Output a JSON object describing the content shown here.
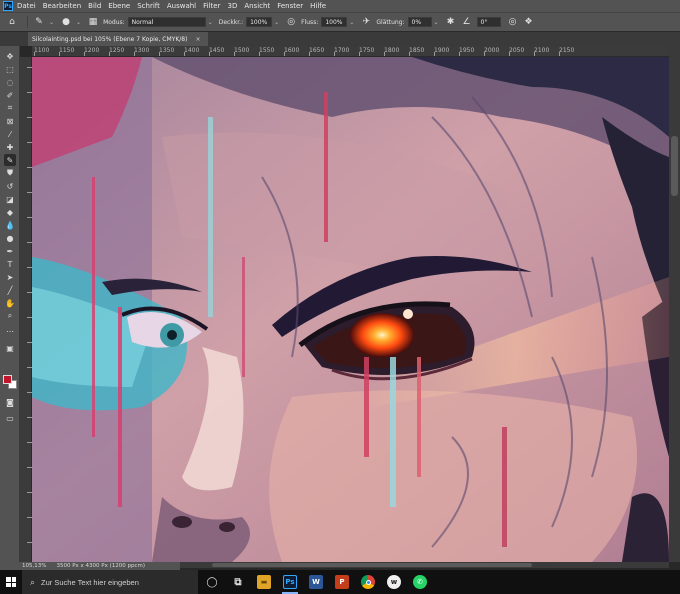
{
  "app": {
    "logo": "Ps"
  },
  "menu": [
    "Datei",
    "Bearbeiten",
    "Bild",
    "Ebene",
    "Schrift",
    "Auswahl",
    "Filter",
    "3D",
    "Ansicht",
    "Fenster",
    "Hilfe"
  ],
  "options": {
    "modus_label": "Modus:",
    "modus_value": "Normal",
    "deckkraft_label": "Deckkr.:",
    "deckkraft_value": "100%",
    "fluss_label": "Fluss:",
    "fluss_value": "100%",
    "glaettung_label": "Glättung:",
    "glaettung_value": "0%",
    "angle_value": "0°"
  },
  "document": {
    "tab_title": "Silcolainting.psd bei 105% (Ebene 7 Kopie, CMYK/8)",
    "close_glyph": "×"
  },
  "ruler": {
    "ticks": [
      "1100",
      "1150",
      "1200",
      "1250",
      "1300",
      "1350",
      "1400",
      "1450",
      "1500",
      "1550",
      "1600",
      "1650",
      "1700",
      "1750",
      "1800",
      "1850",
      "1900",
      "1950",
      "2000",
      "2050",
      "2100",
      "2150"
    ]
  },
  "status": {
    "zoom": "105,13%",
    "doc_info": "3500 Px x 4300 Px (1200 ppcm)"
  },
  "taskbar": {
    "search_placeholder": "Zur Suche Text hier eingeben",
    "apps": [
      {
        "name": "task-view",
        "glyph": "◯",
        "color": "#101010"
      },
      {
        "name": "task-switcher",
        "glyph": "⧉",
        "color": "#101010"
      },
      {
        "name": "file-explorer",
        "glyph": "▬",
        "color": "#e0a526"
      },
      {
        "name": "photoshop",
        "glyph": "Ps",
        "color": "#0d1b33"
      },
      {
        "name": "word",
        "glyph": "W",
        "color": "#2b5797"
      },
      {
        "name": "powerpoint",
        "glyph": "P",
        "color": "#c43e1c"
      },
      {
        "name": "chrome",
        "glyph": "●",
        "color": "#d9463a"
      },
      {
        "name": "wattpad",
        "glyph": "w",
        "color": "#1c1c1c"
      },
      {
        "name": "whatsapp",
        "glyph": "✆",
        "color": "#25d366"
      }
    ]
  },
  "colors": {
    "foreground": "#c0152a",
    "background": "#ffffff",
    "ui_panel": "#535353"
  }
}
